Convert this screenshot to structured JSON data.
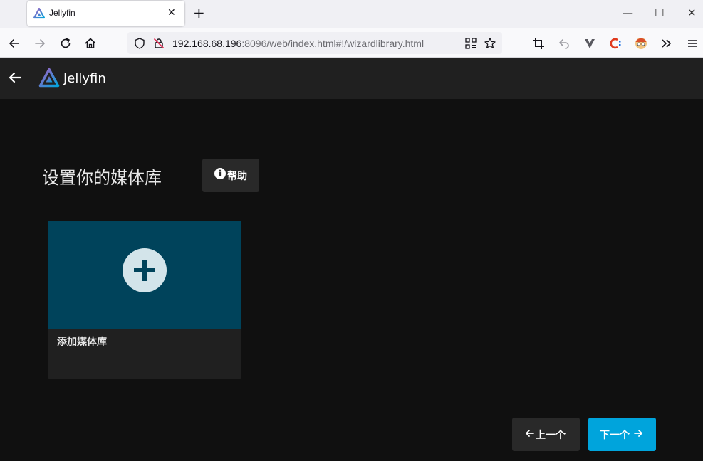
{
  "browser": {
    "tab_title": "Jellyfin",
    "tab_close": "✕",
    "new_tab": "+",
    "window_controls": {
      "minimize": "—",
      "maximize": "☐",
      "close": "✕"
    },
    "url_host": "192.168.68.196",
    "url_rest": ":8096/web/index.html#!/wizardlibrary.html"
  },
  "app": {
    "logo_text": "Jellyfin",
    "page_title": "设置你的媒体库",
    "help_label": "帮助",
    "help_icon_glyph": "i",
    "library_card_label": "添加媒体库",
    "prev_label": "上一个",
    "next_label": "下一个"
  },
  "colors": {
    "accent": "#00a4dc",
    "card_image_bg": "#00435b",
    "header_bg": "#202020",
    "page_bg": "#101010"
  },
  "icons": [
    "jellyfin-logo-icon",
    "back-arrow-icon",
    "info-icon",
    "plus-icon",
    "arrow-left-icon",
    "arrow-right-icon",
    "shield-icon",
    "blocked-lock-icon",
    "qr-code-icon",
    "star-icon",
    "crop-icon",
    "undo-icon",
    "vivaldi-icon",
    "c-extension-icon",
    "avatar-extension-icon",
    "overflow-chevrons-icon",
    "menu-icon"
  ]
}
